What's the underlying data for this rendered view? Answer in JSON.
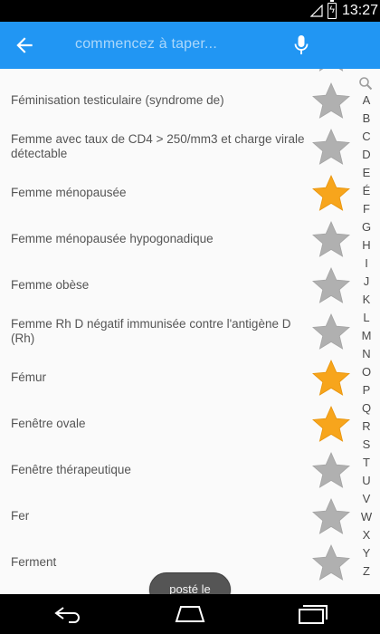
{
  "status_bar": {
    "time": "13:27",
    "battery_icon": "battery-charging-icon",
    "signal_icon": "signal-icon"
  },
  "toolbar": {
    "search_placeholder": "commencez à taper...",
    "back_icon": "back-arrow-icon",
    "mic_icon": "microphone-icon",
    "background": "#2196f3"
  },
  "list": {
    "items": [
      {
        "label": "Féminisation testiculaire (syndrome de)",
        "favorite": false
      },
      {
        "label": "Femme avec taux de CD4 > 250/mm3 et charge virale détectable",
        "favorite": false
      },
      {
        "label": "Femme ménopausée",
        "favorite": true
      },
      {
        "label": "Femme ménopausée hypogonadique",
        "favorite": false
      },
      {
        "label": "Femme obèse",
        "favorite": false
      },
      {
        "label": "Femme Rh D négatif immunisée contre l'antigène D (Rh)",
        "favorite": false
      },
      {
        "label": "Fémur",
        "favorite": true
      },
      {
        "label": "Fenêtre ovale",
        "favorite": true
      },
      {
        "label": "Fenêtre thérapeutique",
        "favorite": false
      },
      {
        "label": "Fer",
        "favorite": false
      },
      {
        "label": "Ferment",
        "favorite": false
      }
    ],
    "colors": {
      "star_on": "#f7a51c",
      "star_off": "#b0b0b0"
    }
  },
  "alphabet_index": {
    "search_icon": "search-icon",
    "letters": [
      "A",
      "B",
      "C",
      "D",
      "E",
      "É",
      "F",
      "G",
      "H",
      "I",
      "J",
      "K",
      "L",
      "M",
      "N",
      "O",
      "P",
      "Q",
      "R",
      "S",
      "T",
      "U",
      "V",
      "W",
      "X",
      "Y",
      "Z"
    ]
  },
  "toast": {
    "text": "posté le"
  },
  "nav_bar": {
    "back_icon": "nav-back-icon",
    "home_icon": "nav-home-icon",
    "recents_icon": "nav-recents-icon"
  }
}
